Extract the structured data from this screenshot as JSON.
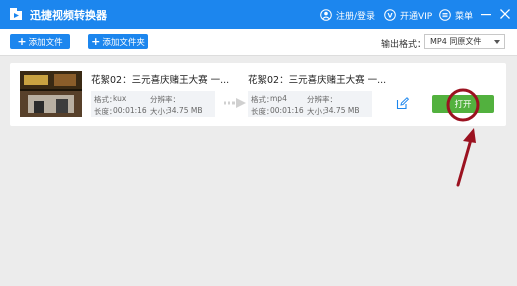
{
  "app": {
    "title": "迅捷视频转换器"
  },
  "titlebar": {
    "register_label": "注册/登录",
    "vip_label": "开通VIP",
    "menu_label": "菜单"
  },
  "toolbar": {
    "add_file_label": "添加文件",
    "add_folder_label": "添加文件夹",
    "output_format_label": "输出格式：",
    "output_format_value": "MP4 同原文件"
  },
  "file": {
    "source": {
      "name": "花絮02：三元喜庆赌王大赛 一...",
      "format_label": "格式：",
      "format_value": "kux",
      "resolution_label": "分辨率：",
      "resolution_value": "",
      "duration_label": "长度：",
      "duration_value": "00:01:16",
      "size_label": "大小：",
      "size_value": "34.75 MB"
    },
    "target": {
      "name": "花絮02：三元喜庆赌王大赛 一...",
      "format_label": "格式：",
      "format_value": "mp4",
      "resolution_label": "分辨率：",
      "resolution_value": "",
      "duration_label": "长度：",
      "duration_value": "00:01:16",
      "size_label": "大小：",
      "size_value": "34.75 MB"
    },
    "open_label": "打开"
  },
  "colors": {
    "brand_blue": "#1c86ee",
    "open_green": "#52b13e",
    "annotation_red": "#9b1220"
  }
}
